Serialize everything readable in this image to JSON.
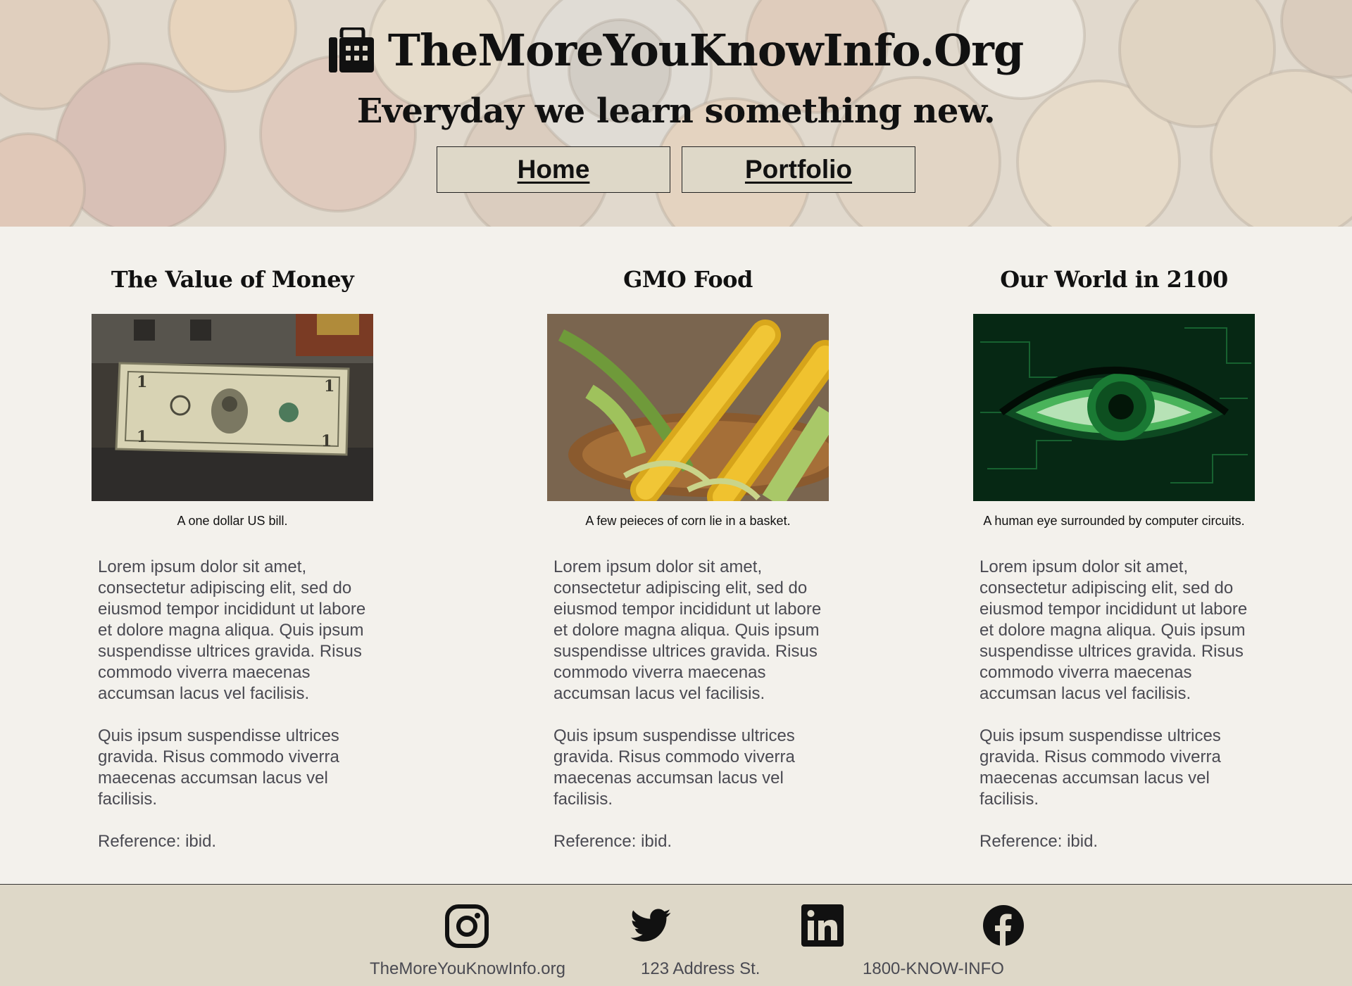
{
  "header": {
    "site_title": "TheMoreYouKnowInfo.Org",
    "tagline": "Everyday we learn something new.",
    "nav": [
      {
        "label": "Home"
      },
      {
        "label": "Portfolio"
      }
    ]
  },
  "articles": [
    {
      "title": "The Value of Money",
      "image_caption": "A one dollar US bill.",
      "paragraphs": [
        "Lorem ipsum dolor sit amet, consectetur adipiscing elit, sed do eiusmod tempor incididunt ut labore et dolore magna aliqua. Quis ipsum suspendisse ultrices gravida. Risus commodo viverra maecenas accumsan lacus vel facilisis.",
        "Quis ipsum suspendisse ultrices gravida. Risus commodo viverra maecenas accumsan lacus vel facilisis.",
        "Reference: ibid."
      ]
    },
    {
      "title": "GMO Food",
      "image_caption": "A few peieces of corn lie in a basket.",
      "paragraphs": [
        "Lorem ipsum dolor sit amet, consectetur adipiscing elit, sed do eiusmod tempor incididunt ut labore et dolore magna aliqua. Quis ipsum suspendisse ultrices gravida. Risus commodo viverra maecenas accumsan lacus vel facilisis.",
        "Quis ipsum suspendisse ultrices gravida. Risus commodo viverra maecenas accumsan lacus vel facilisis.",
        "Reference: ibid."
      ]
    },
    {
      "title": "Our World in 2100",
      "image_caption": "A human eye surrounded by computer circuits.",
      "paragraphs": [
        "Lorem ipsum dolor sit amet, consectetur adipiscing elit, sed do eiusmod tempor incididunt ut labore et dolore magna aliqua. Quis ipsum suspendisse ultrices gravida. Risus commodo viverra maecenas accumsan lacus vel facilisis.",
        "Quis ipsum suspendisse ultrices gravida. Risus commodo viverra maecenas accumsan lacus vel facilisis.",
        "Reference: ibid."
      ]
    }
  ],
  "footer": {
    "social_icons": [
      "instagram-icon",
      "twitter-icon",
      "linkedin-icon",
      "facebook-icon"
    ],
    "website": "TheMoreYouKnowInfo.org",
    "address": "123 Address St.",
    "phone": "1800-KNOW-INFO"
  },
  "colors": {
    "page_background": "#f3f1ec",
    "nav_button_background": "#ded8c8",
    "footer_background": "#ded8c8",
    "body_text": "#4a4a52"
  }
}
